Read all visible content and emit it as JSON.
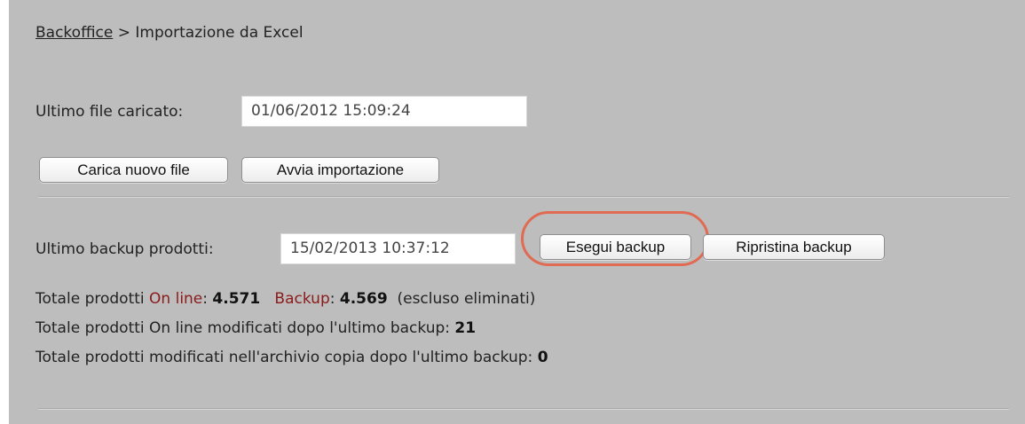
{
  "breadcrumb": {
    "link": "Backoffice",
    "separator": ">",
    "current": "Importazione da Excel"
  },
  "import": {
    "last_file_label": "Ultimo file caricato:",
    "last_file_value": "01/06/2012 15:09:24",
    "upload_button": "Carica nuovo file",
    "import_button": "Avvia importazione"
  },
  "backup": {
    "last_backup_label": "Ultimo backup prodotti:",
    "last_backup_value": "15/02/2013 10:37:12",
    "run_button": "Esegui backup",
    "restore_button": "Ripristina backup"
  },
  "stats": {
    "line1_prefix": "Totale prodotti ",
    "line1_online": "On line",
    "line1_online_value": "4.571",
    "line1_backup": "Backup",
    "line1_backup_value": "4.569",
    "line1_suffix": "(escluso eliminati)",
    "line2_label": "Totale prodotti On line modificati dopo l'ultimo backup:",
    "line2_value": "21",
    "line3_label": "Totale prodotti modificati nell'archivio copia dopo l'ultimo backup:",
    "line3_value": "0"
  },
  "colors": {
    "panel": "#bdbdbd",
    "accent_red": "#8b1a1a",
    "highlight": "#e06a52"
  }
}
